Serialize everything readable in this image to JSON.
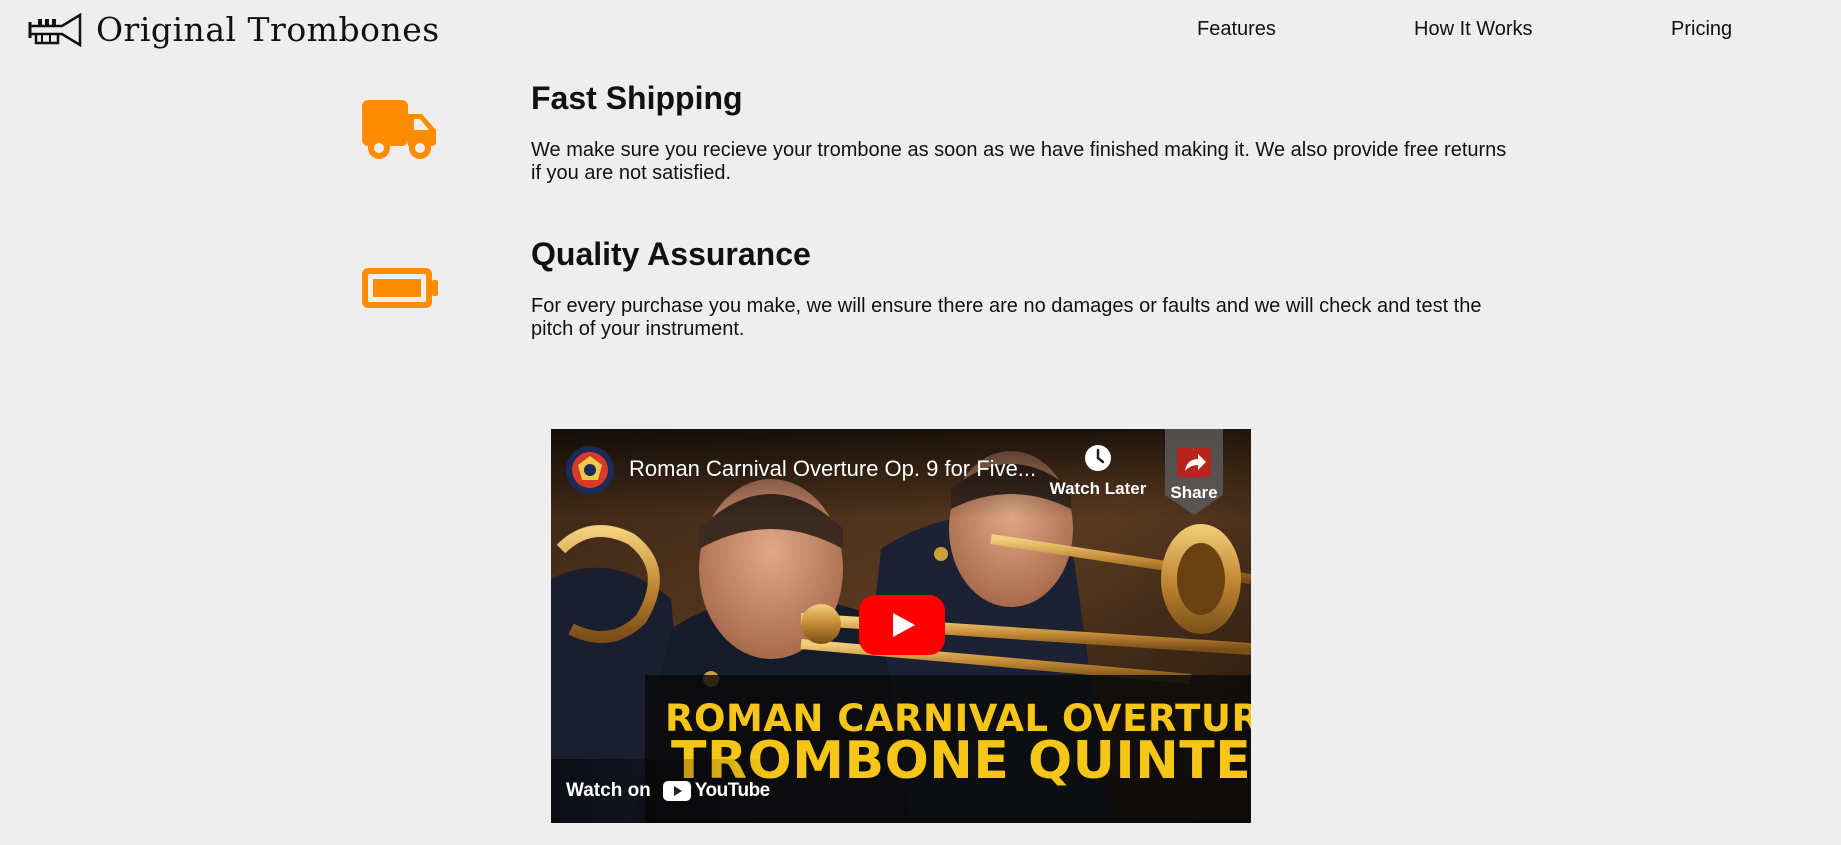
{
  "header": {
    "brand": "Original Trombones",
    "nav": [
      {
        "label": "Features"
      },
      {
        "label": "How It Works"
      },
      {
        "label": "Pricing"
      }
    ]
  },
  "features": [
    {
      "icon": "truck-icon",
      "title": "Fast Shipping",
      "description": "We make sure you recieve your trombone as soon as we have finished making it. We also provide free returns if you are not satisfied."
    },
    {
      "icon": "battery-icon",
      "title": "Quality Assurance",
      "description": "For every purchase you make, we will ensure there are no damages or faults and we will check and test the pitch of your instrument."
    }
  ],
  "video": {
    "title": "Roman Carnival Overture Op. 9 for Five...",
    "watch_later": "Watch Later",
    "share": "Share",
    "banner_line1": "ROMAN CARNIVAL OVERTURE",
    "banner_line2": "TROMBONE QUINTET",
    "watch_on": "Watch on",
    "youtube": "YouTube"
  },
  "colors": {
    "accent": "#ff8c00",
    "background": "#eeeeee",
    "text": "#111111",
    "banner_text": "#f5c518",
    "youtube_red": "#ff0000"
  }
}
